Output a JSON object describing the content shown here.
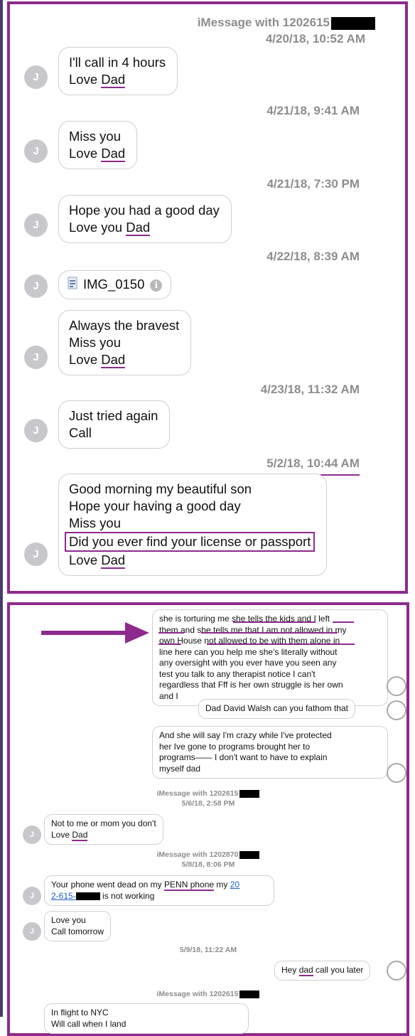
{
  "panel1": {
    "header": {
      "service_label": "iMessage with 1202615",
      "date": "4/20/18, 10:52 AM"
    },
    "avatar_initial": "J",
    "messages": [
      {
        "lines": [
          "I'll call in 4 hours",
          "Love"
        ],
        "tail": "Dad"
      },
      {
        "timestamp": "4/21/18, 9:41 AM",
        "lines": [
          "Miss you",
          "Love"
        ],
        "tail": "Dad"
      },
      {
        "timestamp": "4/21/18, 7:30 PM",
        "lines": [
          "Hope you had a good day",
          "Love you"
        ],
        "tail": "Dad"
      },
      {
        "timestamp": "4/22/18, 8:39 AM",
        "attachment": "IMG_0150"
      },
      {
        "lines": [
          "Always the bravest",
          "Miss you",
          "Love"
        ],
        "tail": "Dad"
      },
      {
        "timestamp": "4/23/18, 11:32 AM",
        "lines": [
          "Just tried again",
          "Call"
        ]
      },
      {
        "timestamp": "5/2/18, 10:44 AM",
        "lines": [
          "Good morning my beautiful son",
          "Hope your having a good day",
          "Miss you",
          "Did you ever find your license or passport",
          "Love"
        ],
        "tail": "Dad"
      }
    ]
  },
  "panel2": {
    "avatar_initial": "J",
    "outgoing": [
      {
        "lines": [
          "she is torturing me she tells the kids and I left",
          "them and she tells me that I am not allowed in my",
          "own House not allowed to be with them alone in",
          "line here can you help me she's literally without",
          "any oversight with you ever have you seen any",
          "test you talk to any therapist notice I can't",
          "regardless that Fff is her own struggle is her own",
          "and I"
        ]
      },
      {
        "text": "Dad David Walsh can you  fathom that"
      },
      {
        "lines": [
          "And she will say I'm crazy while I've protected",
          "her Ive gone to programs brought her to",
          "programs—— I don't want to have to explain",
          "myself dad"
        ]
      }
    ],
    "header1": {
      "service_label": "iMessage with 1202615",
      "date": "5/6/18, 2:58 PM"
    },
    "msg_mom": {
      "line1": "Not to me or mom you don't",
      "line2": "Love",
      "tail": "Dad"
    },
    "header2": {
      "service_label": "iMessage with 1202870",
      "date": "5/8/18, 8:06 PM"
    },
    "msg_phone": {
      "pre": "Your phone went dead on my ",
      "highlight": "PENN phone",
      "mid": " my ",
      "link1": "20",
      "link2": "2-615-",
      "post": " is not working"
    },
    "msg_love": {
      "line1": "Love you",
      "line2": "Call tomorrow"
    },
    "timestamp3": "5/9/18, 11:22 AM",
    "msg_hey": {
      "pre": "Hey ",
      "highlight": "dad",
      "post": " call you later"
    },
    "header4": {
      "service_label": "iMessage with 1202615"
    },
    "msg_flight": {
      "line1": "In flight to NYC",
      "line2": "Will call when I land"
    }
  },
  "colors": {
    "accent": "#8e2a8e",
    "timestamp": "#8d8d8d",
    "link": "#1a5fd0",
    "avatar": "#c7c7cc"
  },
  "icons": [
    "arrow-right-icon",
    "file-icon",
    "info-icon",
    "avatar-outline-icon"
  ]
}
